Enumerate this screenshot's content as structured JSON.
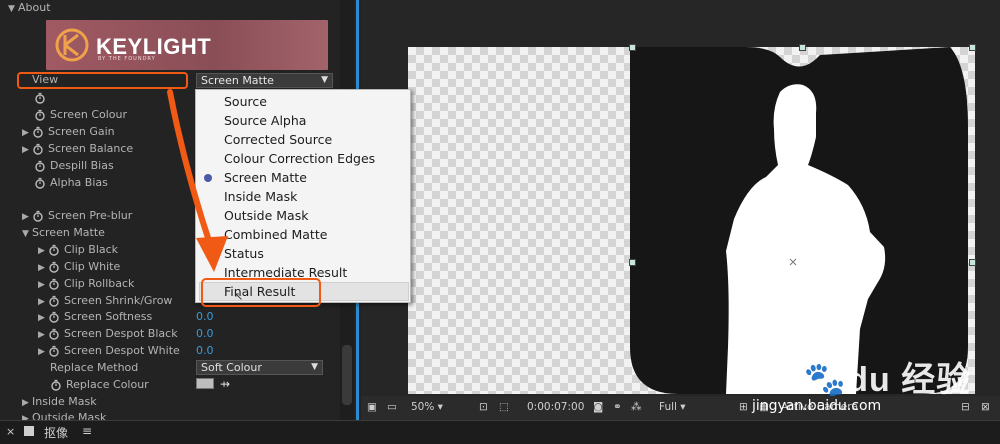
{
  "panel": {
    "about_label": "About",
    "logo_text": "KEYLIGHT",
    "logo_sub": "BY THE FOUNDRY",
    "view_label": "View",
    "view_value": "Screen Matte",
    "screen_colour": "Screen Colour",
    "screen_gain": "Screen Gain",
    "screen_balance": "Screen Balance",
    "despill_bias": "Despill Bias",
    "alpha_bias": "Alpha Bias",
    "screen_preblur": "Screen Pre-blur",
    "screen_matte": "Screen Matte",
    "clip_black": "Clip Black",
    "clip_white": "Clip White",
    "clip_rollback": "Clip Rollback",
    "shrink_grow": "Screen Shrink/Grow",
    "softness": "Screen Softness",
    "softness_val": "0.0",
    "despot_black": "Screen Despot Black",
    "despot_black_val": "0.0",
    "despot_white": "Screen Despot White",
    "despot_white_val": "0.0",
    "replace_method": "Replace Method",
    "replace_method_val": "Soft Colour",
    "replace_colour": "Replace Colour",
    "inside_mask": "Inside Mask",
    "outside_mask": "Outside Mask"
  },
  "menu": {
    "items": [
      "Source",
      "Source Alpha",
      "Corrected Source",
      "Colour Correction Edges",
      "Screen Matte",
      "Inside Mask",
      "Outside Mask",
      "Combined Matte",
      "Status",
      "Intermediate Result",
      "Final Result"
    ],
    "selected": "Screen Matte"
  },
  "toolbar": {
    "zoom": "50%",
    "timecode": "0:00:07:00",
    "resolution": "Full",
    "camera": "Active Camera"
  },
  "bottom": {
    "tab_label": "抠像",
    "menu_icon": "≡"
  },
  "watermark": {
    "brand": "Bai",
    "brand2": "du",
    "cn": "经验",
    "url": "jingyan.baidu.com"
  },
  "colors": {
    "accent_blue": "#2d8ccf",
    "annotation": "#f05a14",
    "value_blue": "#3d9ad8"
  }
}
